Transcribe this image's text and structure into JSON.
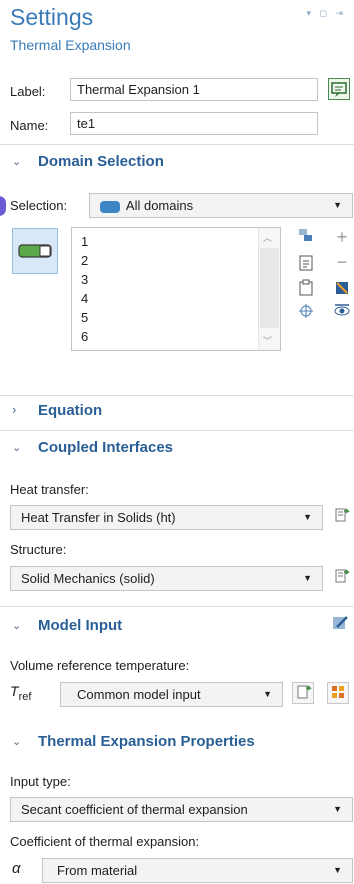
{
  "header": {
    "title": "Settings",
    "subtitle": "Thermal Expansion",
    "window_icons": "▾ ◻ ⇥"
  },
  "label_field": {
    "label": "Label:",
    "value": "Thermal Expansion 1"
  },
  "name_field": {
    "label": "Name:",
    "value": "te1"
  },
  "sections": {
    "domain_selection": "Domain Selection",
    "equation": "Equation",
    "coupled_interfaces": "Coupled Interfaces",
    "model_input": "Model Input",
    "thermal_expansion_properties": "Thermal Expansion Properties"
  },
  "selection": {
    "label": "Selection:",
    "value": "All domains",
    "items": [
      "1",
      "2",
      "3",
      "4",
      "5",
      "6"
    ]
  },
  "coupled": {
    "heat_label": "Heat transfer:",
    "heat_value": "Heat Transfer in Solids (ht)",
    "structure_label": "Structure:",
    "structure_value": "Solid Mechanics (solid)"
  },
  "model_input": {
    "label": "Volume reference temperature:",
    "symbol": "T",
    "subscript": "ref",
    "value": "Common model input"
  },
  "properties": {
    "input_type_label": "Input type:",
    "input_type_value": "Secant coefficient of thermal expansion",
    "coef_label": "Coefficient of thermal expansion:",
    "coef_symbol": "α",
    "coef_value": "From material"
  },
  "icons": [
    "edit-label-icon",
    "domain-toggle-icon",
    "copy-icon",
    "paste-icon",
    "zoom-icon",
    "add-icon",
    "remove-icon",
    "clear-icon",
    "show-icon",
    "go-to-source-icon",
    "edit-icon",
    "model-input-icon"
  ]
}
